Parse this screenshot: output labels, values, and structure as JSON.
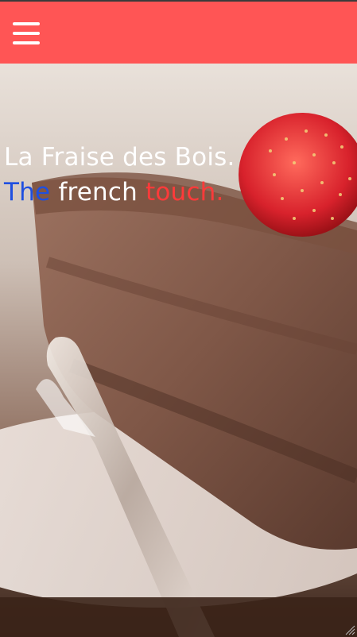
{
  "navbar": {
    "background_color": "#ff5555",
    "menu_icon": "hamburger-menu-icon"
  },
  "hero": {
    "title": "La Fraise des Bois.",
    "tagline": {
      "word1": "The",
      "word2": "french",
      "word3": "touch."
    },
    "colors": {
      "word1": "#1f4fe0",
      "word2": "#ffffff",
      "word3": "#ff3a3a"
    }
  }
}
